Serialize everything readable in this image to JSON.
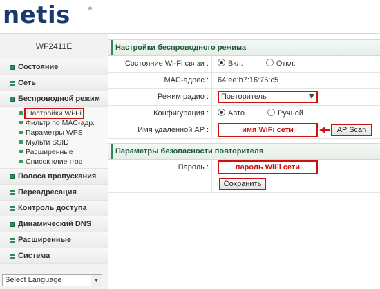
{
  "header": {
    "logo_text": "netis",
    "logo_mark": "®"
  },
  "sidebar": {
    "model": "WF2411E",
    "items": [
      {
        "label": "Состояние",
        "icon": "square-bullet-icon"
      },
      {
        "label": "Сеть",
        "icon": "grid-bullet-icon"
      },
      {
        "label": "Беспроводной режим",
        "icon": "square-bullet-icon"
      },
      {
        "label": "Полоса пропускания",
        "icon": "square-bullet-icon"
      },
      {
        "label": "Переадресация",
        "icon": "grid-bullet-icon"
      },
      {
        "label": "Контроль доступа",
        "icon": "grid-bullet-icon"
      },
      {
        "label": "Динамический DNS",
        "icon": "square-bullet-icon"
      },
      {
        "label": "Расширенные",
        "icon": "grid-bullet-icon"
      },
      {
        "label": "Система",
        "icon": "grid-bullet-icon"
      }
    ],
    "subitems": [
      {
        "label": "Настройки Wi-Fi"
      },
      {
        "label": "Фильтр по MAC-адр."
      },
      {
        "label": "Параметры WPS"
      },
      {
        "label": "Мульти SSID"
      },
      {
        "label": "Расширенные"
      },
      {
        "label": "Список клиентов"
      }
    ],
    "language": "Select Language"
  },
  "wireless": {
    "title": "Настройки беспроводного режима",
    "status_label": "Состояние Wi-Fi связи :",
    "status_on": "Вкл.",
    "status_off": "Откл.",
    "mac_label": "MAC-адрес :",
    "mac_value": "64:ee:b7:16:75:c5",
    "mode_label": "Режим радио :",
    "mode_value": "Повторитель",
    "config_label": "Конфигурация :",
    "config_auto": "Авто",
    "config_manual": "Ручной",
    "remote_ap_label": "Имя удаленной AP :",
    "remote_ap_value": "имя WiFi сети",
    "scan_button": "AP Scan"
  },
  "security": {
    "title": "Параметры безопасности повторителя",
    "password_label": "Пароль :",
    "password_value": "пароль WiFi сети",
    "save_button": "Сохранить"
  },
  "colors": {
    "brand": "#163a6d",
    "accent_green": "#2e8b57",
    "highlight_red": "#cc1111"
  }
}
